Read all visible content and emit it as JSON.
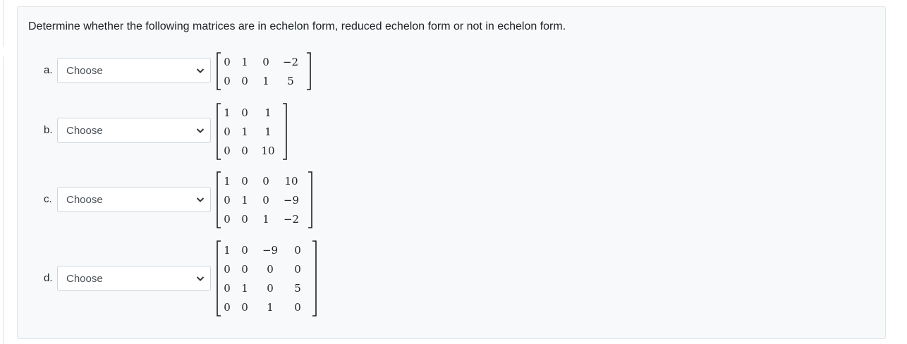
{
  "question": {
    "text": "Determine whether the following matrices are in echelon form, reduced echelon form or not in echelon form."
  },
  "items": [
    {
      "letter": "a.",
      "select": {
        "selected": "Choose"
      },
      "matrix": [
        [
          "0",
          "1",
          "0",
          "−2"
        ],
        [
          "0",
          "0",
          "1",
          "5"
        ]
      ]
    },
    {
      "letter": "b.",
      "select": {
        "selected": "Choose"
      },
      "matrix": [
        [
          "1",
          "0",
          "1"
        ],
        [
          "0",
          "1",
          "1"
        ],
        [
          "0",
          "0",
          "10"
        ]
      ]
    },
    {
      "letter": "c.",
      "select": {
        "selected": "Choose"
      },
      "matrix": [
        [
          "1",
          "0",
          "0",
          "10"
        ],
        [
          "0",
          "1",
          "0",
          "−9"
        ],
        [
          "0",
          "0",
          "1",
          "−2"
        ]
      ]
    },
    {
      "letter": "d.",
      "select": {
        "selected": "Choose"
      },
      "matrix": [
        [
          "1",
          "0",
          "−9",
          "0"
        ],
        [
          "0",
          "0",
          "0",
          "0"
        ],
        [
          "0",
          "1",
          "0",
          "5"
        ],
        [
          "0",
          "0",
          "1",
          "0"
        ]
      ]
    }
  ],
  "icons": {
    "dropdown": "chevron-down-icon"
  },
  "colors": {
    "panel_bg": "#f8f9fa",
    "panel_border": "#dfe3e7",
    "select_border": "#ced4da",
    "text": "#1d2125"
  }
}
